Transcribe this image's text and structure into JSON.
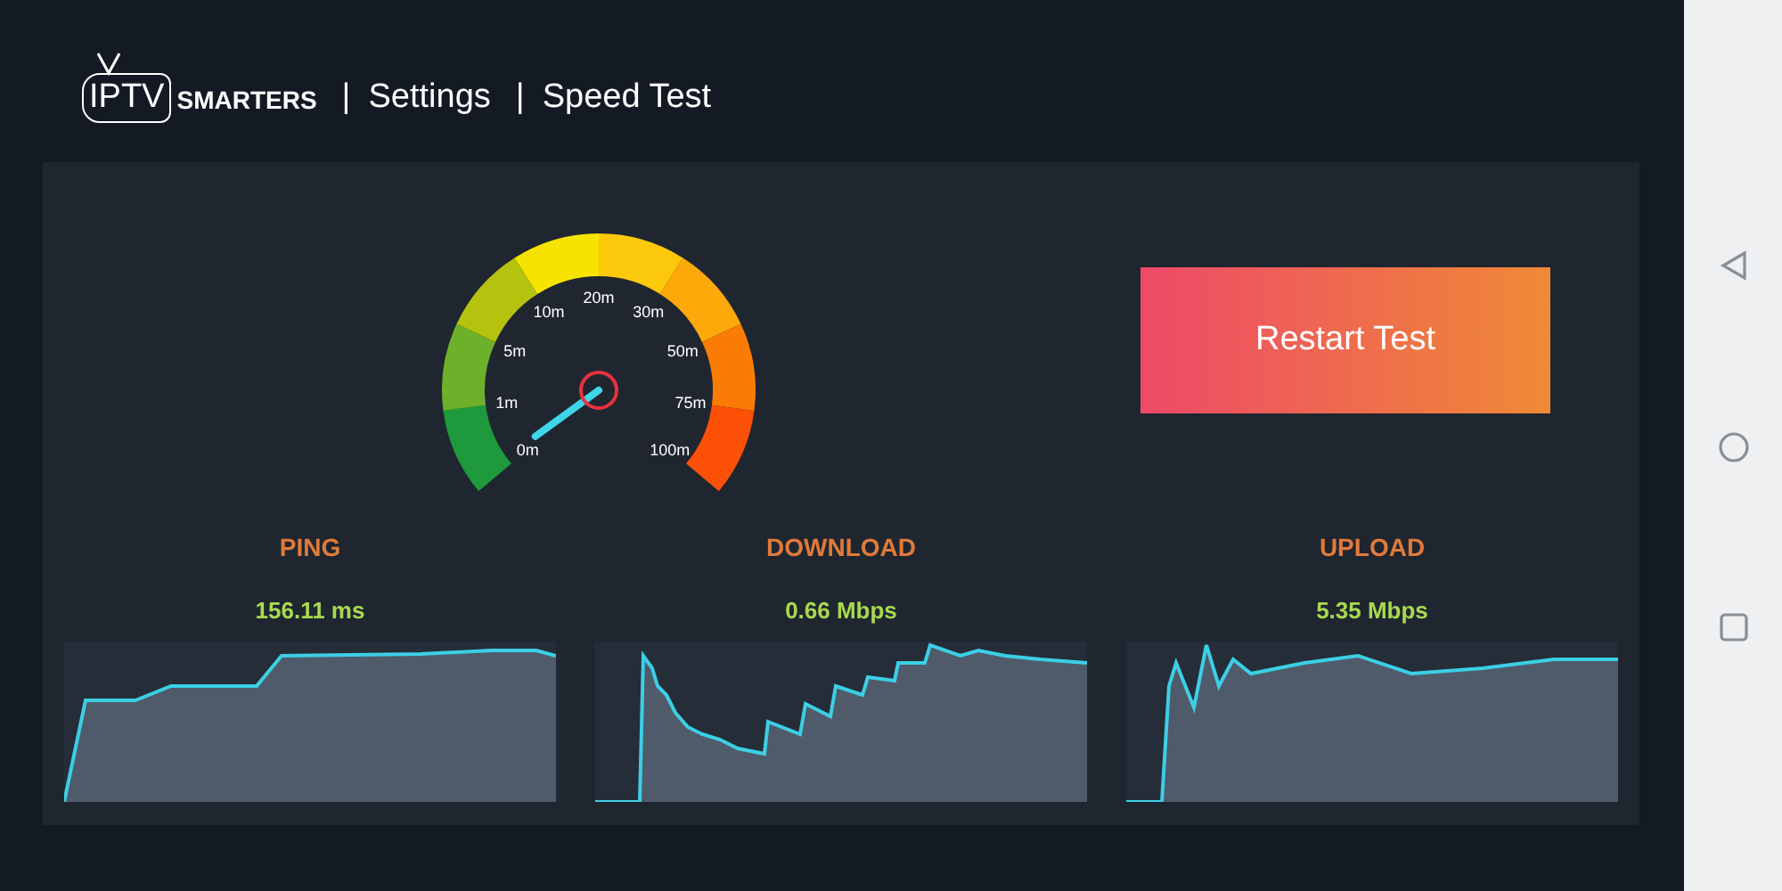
{
  "header": {
    "logo_light": "IPTV",
    "logo_bold": "SMARTERS",
    "crumbs": [
      {
        "separator": "|",
        "label": "Settings"
      },
      {
        "separator": "|",
        "label": "Speed Test"
      }
    ]
  },
  "gauge": {
    "labels": [
      "0m",
      "1m",
      "5m",
      "10m",
      "20m",
      "30m",
      "50m",
      "75m",
      "100m"
    ]
  },
  "restart_button": "Restart Test",
  "results": [
    {
      "title": "PING",
      "value": "156.11 ms"
    },
    {
      "title": "DOWNLOAD",
      "value": "0.66 Mbps"
    },
    {
      "title": "UPLOAD",
      "value": "5.35 Mbps"
    }
  ]
}
